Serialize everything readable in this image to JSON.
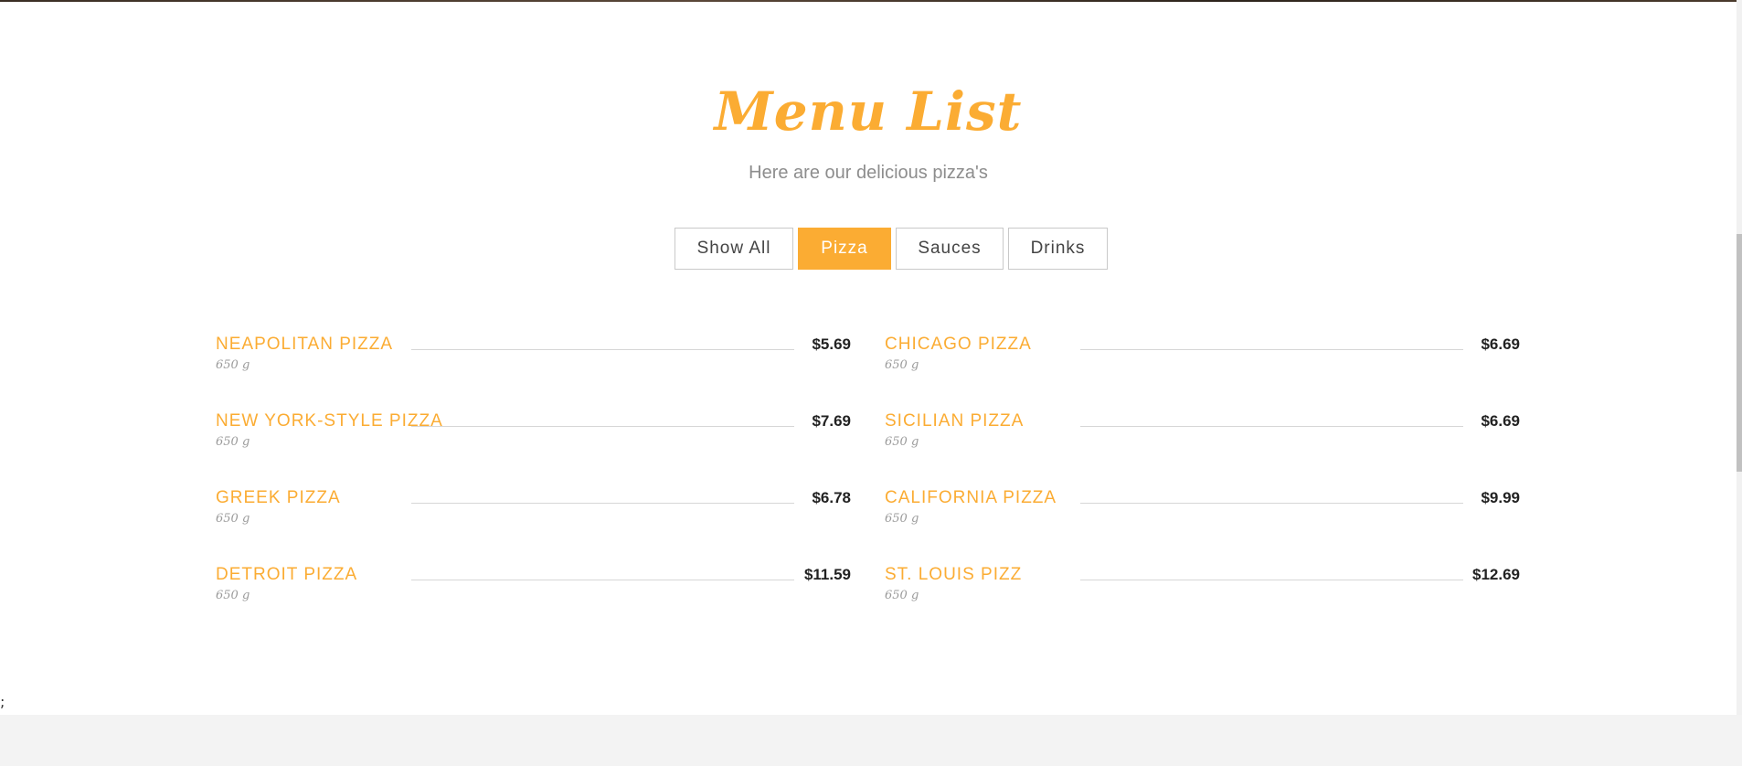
{
  "header": {
    "title": "Menu List",
    "subtitle": "Here are our delicious pizza's"
  },
  "filters": [
    {
      "label": "Show All",
      "active": false
    },
    {
      "label": "Pizza",
      "active": true
    },
    {
      "label": "Sauces",
      "active": false
    },
    {
      "label": "Drinks",
      "active": false
    }
  ],
  "menu": {
    "left": [
      {
        "name": "NEAPOLITAN PIZZA",
        "price": "$5.69",
        "weight": "650 g"
      },
      {
        "name": "NEW YORK-STYLE PIZZA",
        "price": "$7.69",
        "weight": "650 g"
      },
      {
        "name": "GREEK PIZZA",
        "price": "$6.78",
        "weight": "650 g"
      },
      {
        "name": "DETROIT PIZZA",
        "price": "$11.59",
        "weight": "650 g"
      }
    ],
    "right": [
      {
        "name": "CHICAGO PIZZA",
        "price": "$6.69",
        "weight": "650 g"
      },
      {
        "name": "SICILIAN PIZZA",
        "price": "$6.69",
        "weight": "650 g"
      },
      {
        "name": "CALIFORNIA PIZZA",
        "price": "$9.99",
        "weight": "650 g"
      },
      {
        "name": "ST. LOUIS PIZZ",
        "price": "$12.69",
        "weight": "650 g"
      }
    ]
  },
  "stray_text": ";",
  "colors": {
    "accent": "#fbac33",
    "price": "#222222",
    "muted": "#8d8d8d"
  }
}
